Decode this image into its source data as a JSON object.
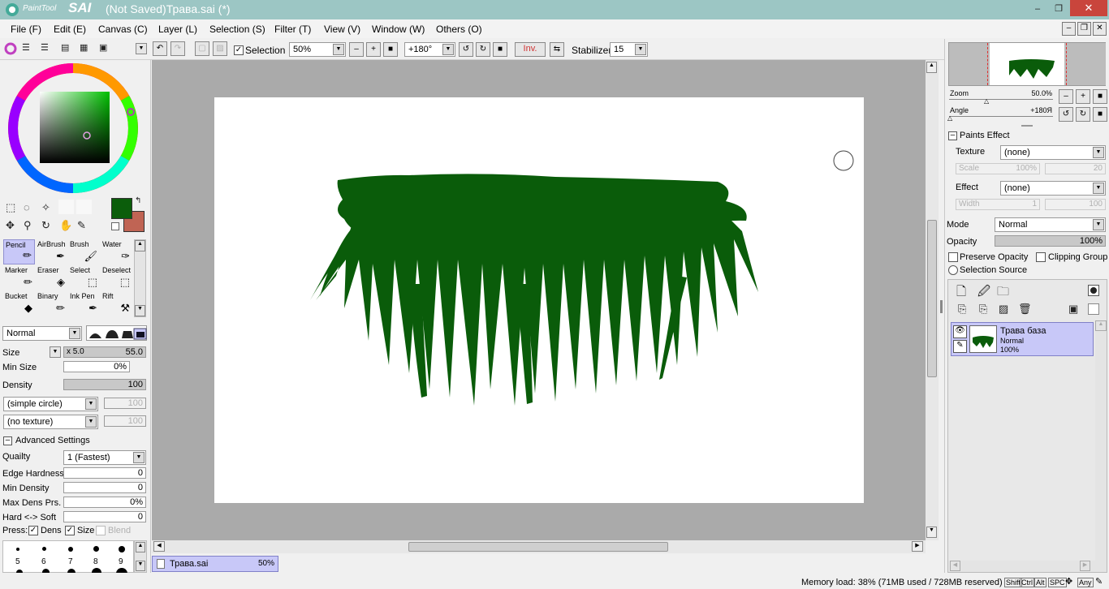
{
  "app": {
    "title": "(Not Saved)Трава.sai (*)",
    "logo_small": "PaintTool",
    "logo_big": "SAI"
  },
  "window_controls": {
    "minimize": "–",
    "restore": "❐",
    "close": "✕"
  },
  "menu": [
    "File (F)",
    "Edit (E)",
    "Canvas (C)",
    "Layer (L)",
    "Selection (S)",
    "Filter (T)",
    "View (V)",
    "Window (W)",
    "Others (O)"
  ],
  "toolbar": {
    "selection_label": "Selection",
    "selection_checked": true,
    "zoom": "50%",
    "rotation": "+180°",
    "invert": "Inv.",
    "stabilizer_label": "Stabilizer",
    "stabilizer": "15"
  },
  "colors": {
    "primary": "#0b5d0b",
    "secondary": "#c06454",
    "grass": "#0a5c0a",
    "accent": "#c8c8f8"
  },
  "tools": [
    {
      "name": "Pencil",
      "icon": "pencil-icon"
    },
    {
      "name": "AirBrush",
      "icon": "airbrush-icon"
    },
    {
      "name": "Brush",
      "icon": "brush-icon"
    },
    {
      "name": "Water",
      "icon": "water-icon"
    },
    {
      "name": "Marker",
      "icon": "marker-icon"
    },
    {
      "name": "Eraser",
      "icon": "eraser-icon"
    },
    {
      "name": "Select",
      "icon": "select-icon"
    },
    {
      "name": "Deselect",
      "icon": "deselect-icon"
    },
    {
      "name": "Bucket",
      "icon": "bucket-icon"
    },
    {
      "name": "Binary",
      "icon": "binary-icon"
    },
    {
      "name": "Ink Pen",
      "icon": "inkpen-icon"
    },
    {
      "name": "Rift",
      "icon": "rift-icon"
    }
  ],
  "brush": {
    "blend_mode": "Normal",
    "size_label": "Size",
    "size_mult": "x 5.0",
    "size": "55.0",
    "min_size_label": "Min Size",
    "min_size": "0%",
    "density_label": "Density",
    "density": "100",
    "shape": "(simple circle)",
    "shape_value": "100",
    "texture": "(no texture)",
    "texture_value": "100",
    "advanced_label": "Advanced Settings",
    "quality_label": "Quailty",
    "quality": "1 (Fastest)",
    "edge_label": "Edge Hardness",
    "edge": "0",
    "min_density_label": "Min Density",
    "min_density": "0",
    "max_dens_label": "Max Dens Prs.",
    "max_dens": "0%",
    "hard_soft_label": "Hard <-> Soft",
    "hard_soft": "0",
    "press_label": "Press:",
    "press_dens": "Dens",
    "press_size": "Size",
    "press_blend": "Blend"
  },
  "brush_sizes": [
    "5",
    "6",
    "7",
    "8",
    "9"
  ],
  "document_tab": {
    "name": "Трава.sai",
    "zoom": "50%"
  },
  "navigator": {
    "zoom_label": "Zoom",
    "zoom": "50.0%",
    "angle_label": "Angle",
    "angle": "+180Я"
  },
  "paints_effect": {
    "header": "Paints Effect",
    "texture_label": "Texture",
    "texture": "(none)",
    "scale_label": "Scale",
    "scale": "100%",
    "scale_right": "20",
    "effect_label": "Effect",
    "effect": "(none)",
    "width_label": "Width",
    "width": "1",
    "width_right": "100"
  },
  "layer_props": {
    "mode_label": "Mode",
    "mode": "Normal",
    "opacity_label": "Opacity",
    "opacity": "100%",
    "preserve_opacity": "Preserve Opacity",
    "clipping_group": "Clipping Group",
    "selection_source": "Selection Source"
  },
  "layers": [
    {
      "name": "Трава база",
      "mode": "Normal",
      "opacity": "100%"
    }
  ],
  "status": {
    "memory": "Memory load: 38% (71MB used / 728MB reserved)",
    "keys": [
      "Shift",
      "Ctrl",
      "Alt",
      "SPC",
      "Any"
    ]
  }
}
